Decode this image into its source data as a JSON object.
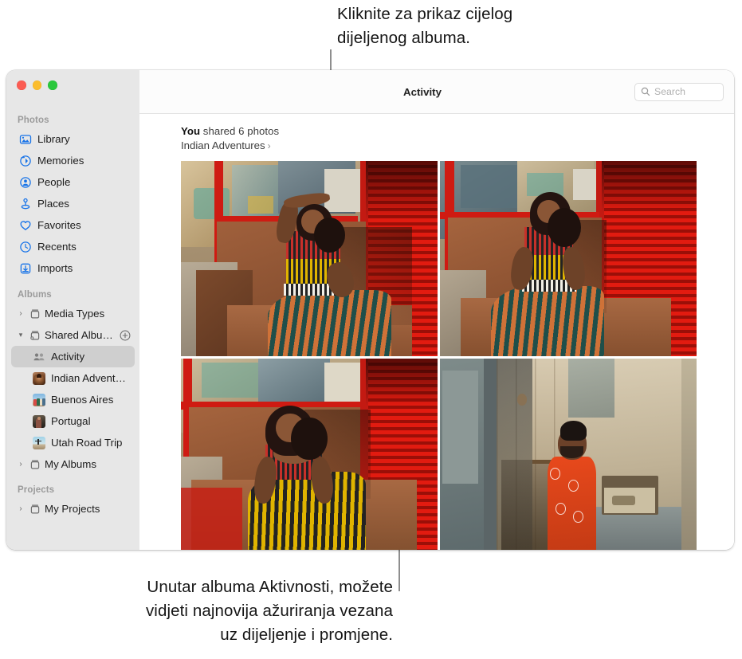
{
  "annotations": {
    "top_callout": "Kliknite za prikaz cijelog\ndijeljenog albuma.",
    "bottom_callout": "Unutar albuma Aktivnosti, možete\nvidjeti najnovija ažuriranja vezana\nuz dijeljenje i promjene."
  },
  "window": {
    "traffic_lights": {
      "close_label": "close-window",
      "minimize_label": "minimize-window",
      "zoom_label": "zoom-window",
      "close_color": "#fb5c53",
      "minimize_color": "#fbbd2d",
      "zoom_color": "#2ac83c"
    }
  },
  "toolbar": {
    "title": "Activity",
    "search_placeholder": "Search",
    "search_value": ""
  },
  "sidebar": {
    "sections": [
      {
        "title": "Photos",
        "items": [
          {
            "label": "Library",
            "icon": "library-icon",
            "selected": false
          },
          {
            "label": "Memories",
            "icon": "memories-icon",
            "selected": false
          },
          {
            "label": "People",
            "icon": "people-icon",
            "selected": false
          },
          {
            "label": "Places",
            "icon": "places-icon",
            "selected": false
          },
          {
            "label": "Favorites",
            "icon": "heart-icon",
            "selected": false
          },
          {
            "label": "Recents",
            "icon": "clock-icon",
            "selected": false
          },
          {
            "label": "Imports",
            "icon": "imports-icon",
            "selected": false
          }
        ]
      },
      {
        "title": "Albums",
        "groups": [
          {
            "label": "Media Types",
            "icon": "album-stack-icon",
            "expanded": false,
            "disclosure": "›"
          },
          {
            "label": "Shared Albu…",
            "icon": "shared-album-icon",
            "expanded": true,
            "disclosure": "⌄",
            "add_button": "add-shared-album-button"
          }
        ],
        "shared_children": [
          {
            "label": "Activity",
            "icon": "people-group-icon",
            "selected": true
          },
          {
            "label": "Indian Advent…",
            "icon": "album-thumbnail",
            "selected": false
          },
          {
            "label": "Buenos Aires",
            "icon": "album-thumbnail",
            "selected": false
          },
          {
            "label": "Portugal",
            "icon": "album-thumbnail",
            "selected": false
          },
          {
            "label": "Utah Road Trip",
            "icon": "album-thumbnail",
            "selected": false
          }
        ],
        "trailing_groups": [
          {
            "label": "My Albums",
            "icon": "album-stack-icon",
            "expanded": false,
            "disclosure": "›"
          }
        ]
      },
      {
        "title": "Projects",
        "groups": [
          {
            "label": "My Projects",
            "icon": "album-stack-icon",
            "expanded": false,
            "disclosure": "›"
          }
        ]
      }
    ]
  },
  "activity": {
    "actor": "You",
    "action": "shared 6 photos",
    "album_link": "Indian Adventures",
    "album_link_chevron": "›",
    "photos": [
      {
        "name": "photo-1-woman-hand-on-head"
      },
      {
        "name": "photo-2-woman-seated-red-shutter"
      },
      {
        "name": "photo-3-woman-eyes-closed"
      },
      {
        "name": "photo-4-man-orange-kurta"
      }
    ]
  }
}
